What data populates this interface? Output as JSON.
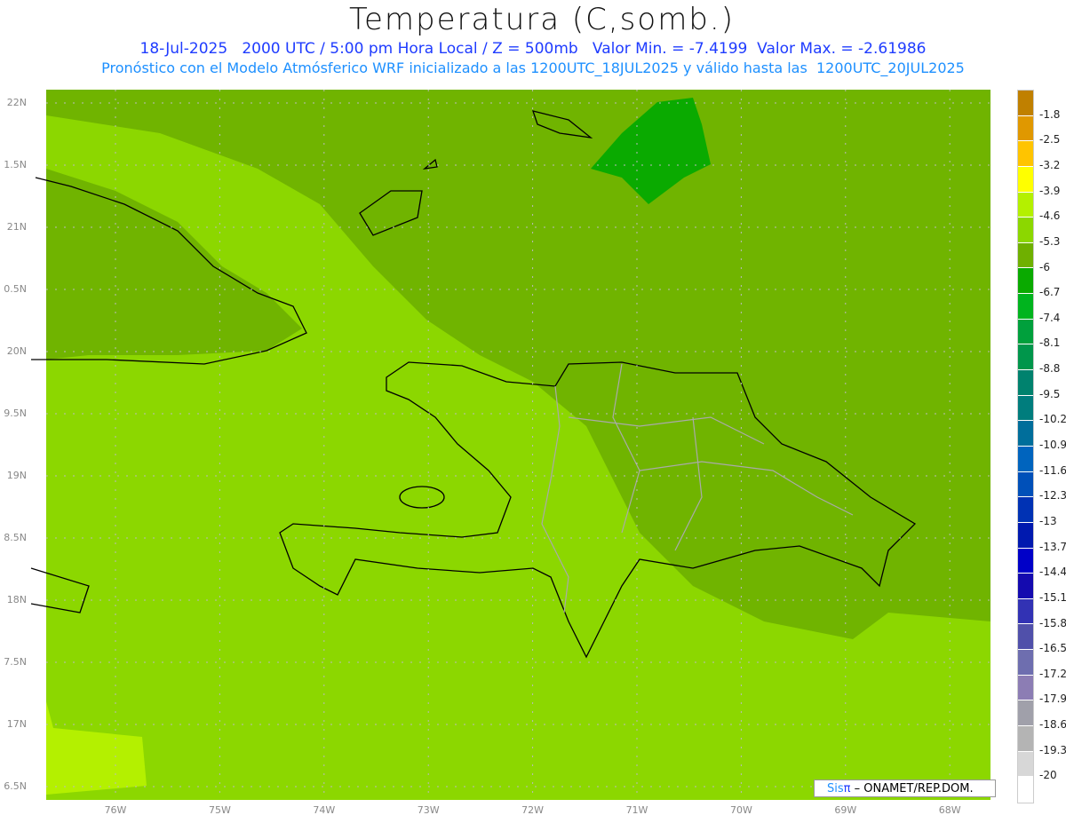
{
  "header": {
    "title": "Temperatura (C,somb.)",
    "line1": "18-Jul-2025   2000 UTC / 5:00 pm Hora Local / Z = 500mb   Valor Min. = -7.4199  Valor Max. = -2.61986",
    "line2": "Pronóstico con el Modelo Atmósferico WRF inicializado a las 1200UTC_18JUL2025 y válido hasta las  1200UTC_20JUL2025"
  },
  "map": {
    "lat_labels": [
      "22N",
      "1.5N",
      "21N",
      "0.5N",
      "20N",
      "9.5N",
      "19N",
      "8.5N",
      "18N",
      "7.5N",
      "17N",
      "6.5N"
    ],
    "lon_labels": [
      "76W",
      "75W",
      "74W",
      "73W",
      "72W",
      "71W",
      "70W",
      "69W",
      "68W"
    ]
  },
  "colorbar": {
    "colors": [
      "#c08000",
      "#e09800",
      "#ffc400",
      "#ffff00",
      "#b4f000",
      "#8cd700",
      "#6fb000",
      "#0aaa00",
      "#00b41e",
      "#00a03c",
      "#00964b",
      "#00826e",
      "#007d7d",
      "#006e9b",
      "#0064be",
      "#0050b9",
      "#0032b4",
      "#0019af",
      "#0000c8",
      "#140aaf",
      "#3232b4",
      "#5050aa",
      "#6e6eaf",
      "#8c7db4",
      "#a0a0aa",
      "#b4b4b4",
      "#d7d7d7",
      "#ffffff"
    ],
    "labels": [
      "-1.8",
      "-2.5",
      "-3.2",
      "-3.9",
      "-4.6",
      "-5.3",
      "-6",
      "-6.7",
      "-7.4",
      "-8.1",
      "-8.8",
      "-9.5",
      "-10.2",
      "-10.9",
      "-11.6",
      "-12.3",
      "-13",
      "-13.7",
      "-14.4",
      "-15.1",
      "-15.8",
      "-16.5",
      "-17.2",
      "-17.9",
      "-18.6",
      "-19.3",
      "-20"
    ]
  },
  "credit": {
    "sis": "Sis",
    "pi": "π",
    "rest": " – ONAMET/REP.DOM."
  }
}
